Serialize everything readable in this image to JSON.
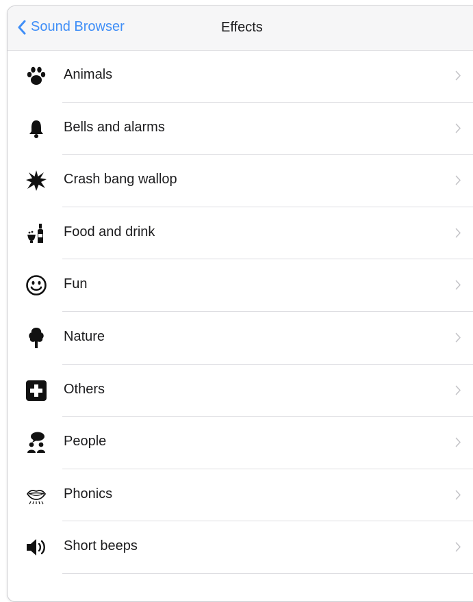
{
  "nav": {
    "back_label": "Sound Browser",
    "title": "Effects"
  },
  "colors": {
    "accent": "#3f8ef7",
    "text": "#1c1c1e",
    "separator": "#dcdce0",
    "navbar_bg": "#f6f6f7"
  },
  "categories": [
    {
      "label": "Animals",
      "icon": "paw-icon"
    },
    {
      "label": "Bells and alarms",
      "icon": "bell-icon"
    },
    {
      "label": "Crash bang wallop",
      "icon": "explosion-icon"
    },
    {
      "label": "Food and drink",
      "icon": "food-drink-icon"
    },
    {
      "label": "Fun",
      "icon": "smiley-icon"
    },
    {
      "label": "Nature",
      "icon": "tree-icon"
    },
    {
      "label": "Others",
      "icon": "plus-square-icon"
    },
    {
      "label": "People",
      "icon": "people-icon"
    },
    {
      "label": "Phonics",
      "icon": "mouth-icon"
    },
    {
      "label": "Short beeps",
      "icon": "speaker-icon"
    }
  ]
}
